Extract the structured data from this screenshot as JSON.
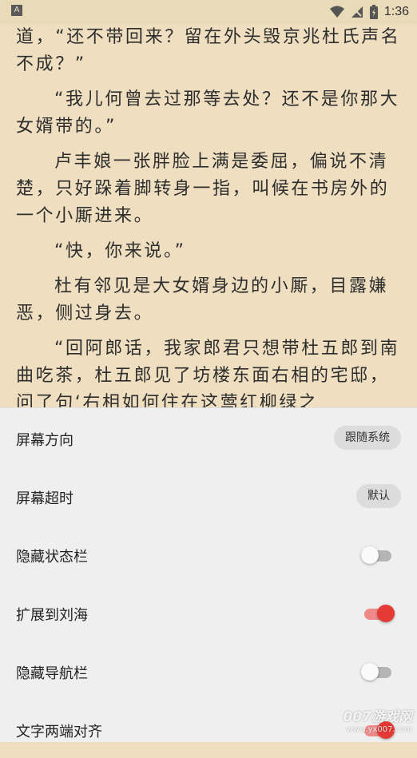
{
  "status_bar": {
    "app_icon_letter": "A",
    "time": "1:36"
  },
  "reader": {
    "paragraphs": [
      "道，“还不带回来？留在外头毁京兆杜氏声名不成？”",
      "“我儿何曾去过那等去处？还不是你那大女婿带的。”",
      "卢丰娘一张胖脸上满是委屈，偏说不清楚，只好跺着脚转身一指，叫候在书房外的一个小厮进来。",
      "“快，你来说。”",
      "杜有邻见是大女婿身边的小厮，目露嫌恶，侧过身去。",
      "“回阿郎话，我家郎君只想带杜五郎到南曲吃茶，杜五郎见了坊楼东面右相的宅邸，问了句‘右相如何住在这莺红柳绿之"
    ]
  },
  "settings": {
    "screen_orientation": {
      "label": "屏幕方向",
      "value": "跟随系统"
    },
    "screen_timeout": {
      "label": "屏幕超时",
      "value": "默认"
    },
    "hide_status_bar": {
      "label": "隐藏状态栏",
      "on": false
    },
    "extend_to_notch": {
      "label": "扩展到刘海",
      "on": true
    },
    "hide_nav_bar": {
      "label": "隐藏导航栏",
      "on": false
    },
    "text_justify": {
      "label": "文字两端对齐",
      "on": true
    }
  },
  "watermark": {
    "main": "007游戏网",
    "sub": "www.yx007.com"
  },
  "colors": {
    "accent": "#e53935",
    "reader_bg": "#efdfc0",
    "sheet_bg": "#efefef"
  }
}
